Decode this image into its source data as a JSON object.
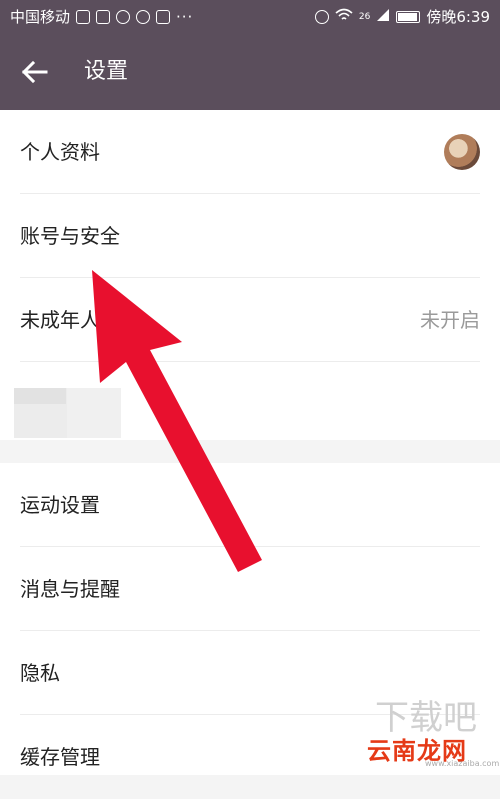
{
  "status_bar": {
    "carrier": "中国移动",
    "net": "26",
    "time": "傍晚6:39"
  },
  "header": {
    "title": "设置"
  },
  "settings_group_1": [
    {
      "label": "个人资料",
      "value": ""
    },
    {
      "label": "账号与安全",
      "value": ""
    },
    {
      "label": "未成年人模式",
      "value": "未开启"
    }
  ],
  "settings_group_2": [
    {
      "label": "运动设置"
    },
    {
      "label": "消息与提醒"
    },
    {
      "label": "隐私"
    },
    {
      "label": "缓存管理"
    }
  ],
  "watermark": {
    "logo_text": "下载吧",
    "site_name": "云南龙网",
    "url": "www.xiazaiba.com"
  },
  "colors": {
    "header_bg": "#5b4e5c",
    "arrow": "#e8102e"
  }
}
